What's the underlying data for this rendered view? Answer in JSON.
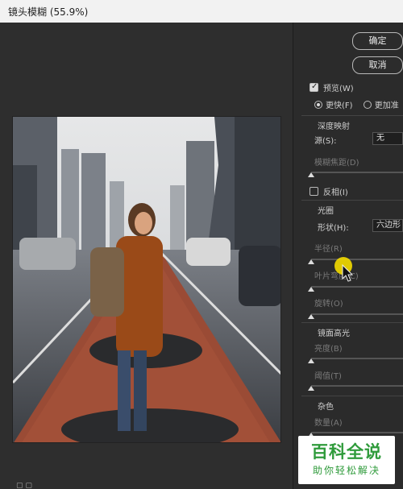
{
  "window": {
    "title": "镜头模糊 (55.9%)"
  },
  "buttons": {
    "ok": "确定",
    "cancel": "取消"
  },
  "preview": {
    "label": "预览(W)",
    "checked": true
  },
  "quality": {
    "faster": "更快(F)",
    "more_accurate": "更加准"
  },
  "depth_map": {
    "heading": "深度映射",
    "source_label": "源(S):",
    "source_value": "无",
    "blur_focal_label": "模糊焦距(D)",
    "invert_label": "反相(I)"
  },
  "iris": {
    "heading": "光圈",
    "shape_label": "形状(H):",
    "shape_value": "六边形",
    "radius_label": "半径(R)",
    "blade_label": "叶片弯度(C)",
    "rotation_label": "旋转(O)"
  },
  "specular": {
    "heading": "镜面高光",
    "brightness_label": "亮度(B)",
    "threshold_label": "阈值(T)"
  },
  "noise": {
    "heading": "杂色",
    "amount_label": "数量(A)"
  },
  "watermark": {
    "line1": "百科全说",
    "line2": "助你轻松解决"
  }
}
